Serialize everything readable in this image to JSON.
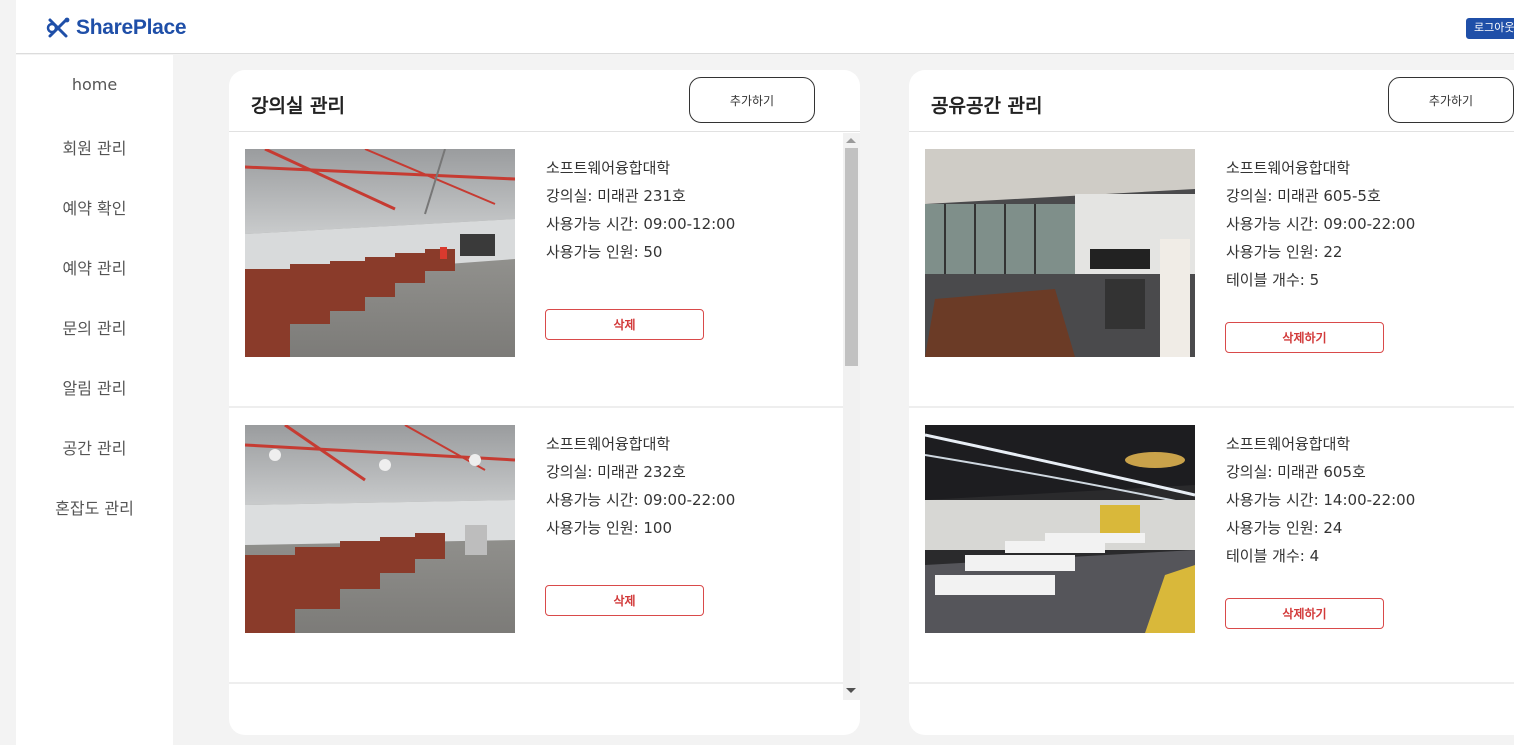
{
  "header": {
    "brand": "SharePlace",
    "logout_label": "로그아웃"
  },
  "sidebar": {
    "items": [
      "home",
      "회원 관리",
      "예약 확인",
      "예약 관리",
      "문의 관리",
      "알림 관리",
      "공간 관리",
      "혼잡도 관리"
    ]
  },
  "lecture": {
    "title": "강의실 관리",
    "add_label": "추가하기",
    "items": [
      {
        "school": "소프트웨어융합대학",
        "room": "강의실: 미래관 231호",
        "time": "사용가능 시간: 09:00-12:00",
        "capacity": "사용가능 인원: 50",
        "delete_label": "삭제"
      },
      {
        "school": "소프트웨어융합대학",
        "room": "강의실: 미래관 232호",
        "time": "사용가능 시간: 09:00-22:00",
        "capacity": "사용가능 인원: 100",
        "delete_label": "삭제"
      }
    ]
  },
  "shared": {
    "title": "공유공간 관리",
    "add_label": "추가하기",
    "items": [
      {
        "school": "소프트웨어융합대학",
        "room": "강의실: 미래관 605-5호",
        "time": "사용가능 시간: 09:00-22:00",
        "capacity": "사용가능 인원: 22",
        "tables": "테이블 개수: 5",
        "delete_label": "삭제하기"
      },
      {
        "school": "소프트웨어융합대학",
        "room": "강의실: 미래관 605호",
        "time": "사용가능 시간: 14:00-22:00",
        "capacity": "사용가능 인원: 24",
        "tables": "테이블 개수: 4",
        "delete_label": "삭제하기"
      }
    ]
  },
  "colors": {
    "brand": "#1f4fa8",
    "danger": "#d94a4a",
    "background": "#f3f3f3"
  },
  "icons": [
    "shareplace-logo-icon",
    "scroll-up-arrow-icon",
    "scroll-down-arrow-icon"
  ]
}
